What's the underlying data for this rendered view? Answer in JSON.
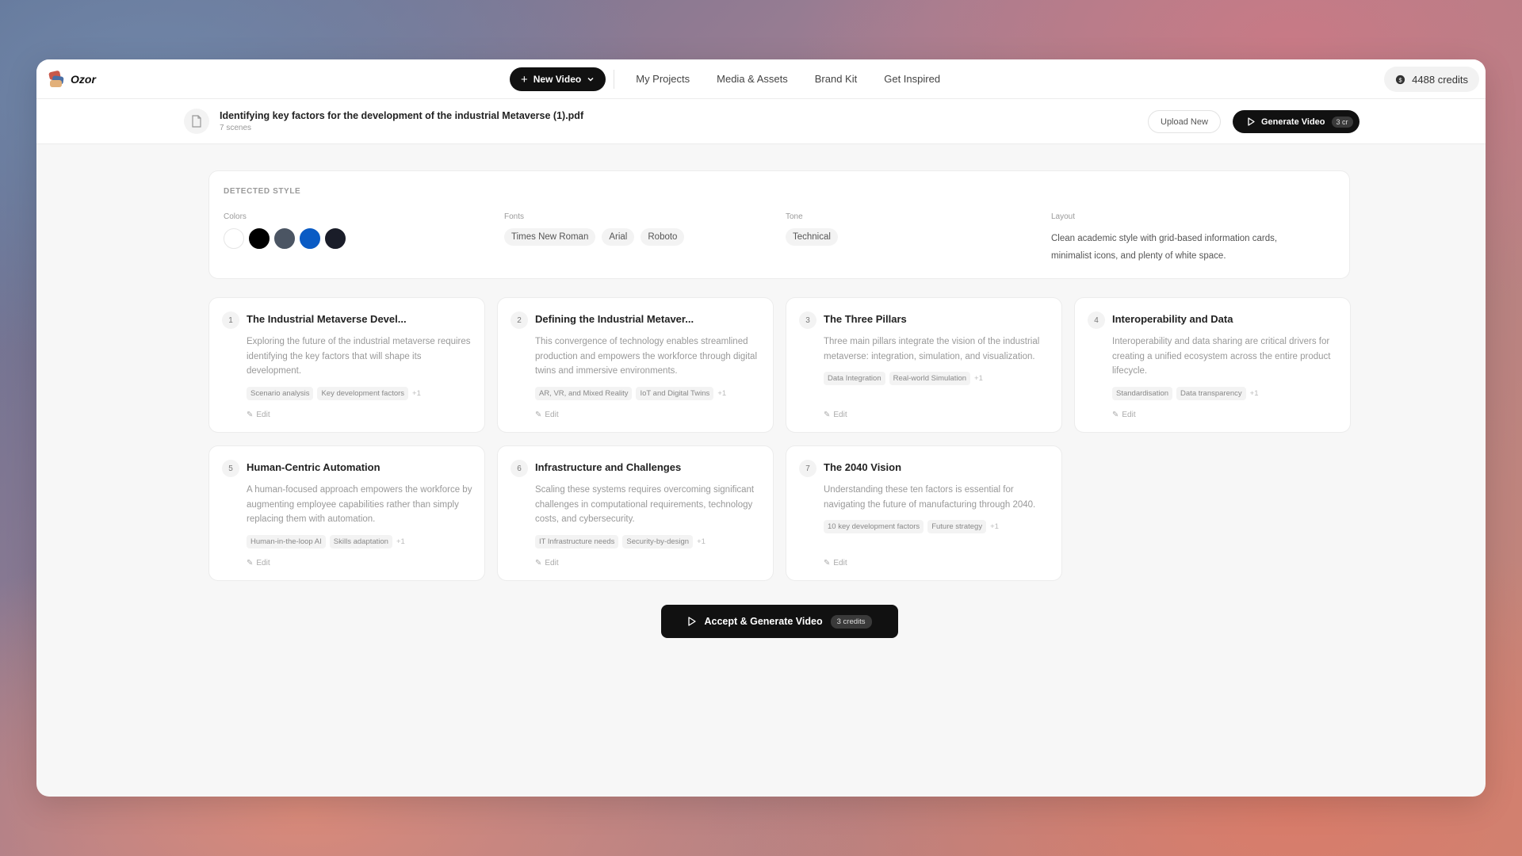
{
  "app": {
    "name": "Ozor"
  },
  "nav": {
    "new_video_label": "New Video",
    "links": [
      "My Projects",
      "Media & Assets",
      "Brand Kit",
      "Get Inspired"
    ],
    "credits": "4488 credits"
  },
  "file": {
    "name": "Identifying key factors for the development of the industrial Metaverse (1).pdf",
    "scenes": "7 scenes"
  },
  "actions": {
    "upload_label": "Upload New",
    "generate_label": "Generate Video",
    "generate_cost": "3 cr"
  },
  "style": {
    "title": "DETECTED STYLE",
    "colors_label": "Colors",
    "colors": [
      "#ffffff",
      "#000000",
      "#4b5563",
      "#0a5bc4",
      "#1a1d29"
    ],
    "fonts_label": "Fonts",
    "fonts": [
      "Times New Roman",
      "Arial",
      "Roboto"
    ],
    "tone_label": "Tone",
    "tone": "Technical",
    "layout_label": "Layout",
    "layout": "Clean academic style with grid-based information cards, minimalist icons, and plenty of white space."
  },
  "scenes": [
    {
      "num": "1",
      "title": "The Industrial Metaverse Devel...",
      "desc": "Exploring the future of the industrial metaverse requires identifying the key factors that will shape its development.",
      "tags": [
        "Scenario analysis",
        "Key development factors"
      ],
      "more": "+1",
      "edit": "Edit"
    },
    {
      "num": "2",
      "title": "Defining the Industrial Metaver...",
      "desc": "This convergence of technology enables streamlined production and empowers the workforce through digital twins and immersive environments.",
      "tags": [
        "AR, VR, and Mixed Reality",
        "IoT and Digital Twins"
      ],
      "more": "+1",
      "edit": "Edit"
    },
    {
      "num": "3",
      "title": "The Three Pillars",
      "desc": "Three main pillars integrate the vision of the industrial metaverse: integration, simulation, and visualization.",
      "tags": [
        "Data Integration",
        "Real-world Simulation"
      ],
      "more": "+1",
      "edit": "Edit"
    },
    {
      "num": "4",
      "title": "Interoperability and Data",
      "desc": "Interoperability and data sharing are critical drivers for creating a unified ecosystem across the entire product lifecycle.",
      "tags": [
        "Standardisation",
        "Data transparency"
      ],
      "more": "+1",
      "edit": "Edit"
    },
    {
      "num": "5",
      "title": "Human-Centric Automation",
      "desc": "A human-focused approach empowers the workforce by augmenting employee capabilities rather than simply replacing them with automation.",
      "tags": [
        "Human-in-the-loop AI",
        "Skills adaptation"
      ],
      "more": "+1",
      "edit": "Edit"
    },
    {
      "num": "6",
      "title": "Infrastructure and Challenges",
      "desc": "Scaling these systems requires overcoming significant challenges in computational requirements, technology costs, and cybersecurity.",
      "tags": [
        "IT Infrastructure needs",
        "Security-by-design"
      ],
      "more": "+1",
      "edit": "Edit"
    },
    {
      "num": "7",
      "title": "The 2040 Vision",
      "desc": "Understanding these ten factors is essential for navigating the future of manufacturing through 2040.",
      "tags": [
        "10 key development factors",
        "Future strategy"
      ],
      "more": "+1",
      "edit": "Edit"
    }
  ],
  "cta": {
    "label": "Accept & Generate Video",
    "cost": "3 credits"
  }
}
